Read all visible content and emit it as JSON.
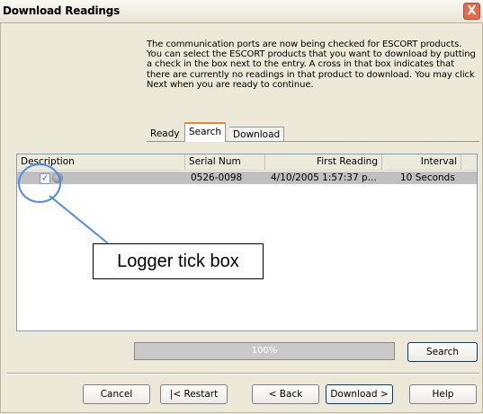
{
  "window": {
    "title": "Download Readings",
    "close": "X"
  },
  "intro_text": "The communication ports are now being checked for ESCORT products. You can select the ESCORT products that you want to download by putting a check in the box next to the entry. A cross in that box indicates that there are currently no readings in that product to download. You may click Next when you are ready to continue.",
  "tabs": [
    {
      "label": "Ready"
    },
    {
      "label": "Search"
    },
    {
      "label": "Download"
    }
  ],
  "list": {
    "columns": {
      "description": "Description",
      "serial": "Serial Num",
      "first": "First Reading",
      "interval": "Interval"
    },
    "rows": [
      {
        "checked": "✓",
        "serial": "0526-0098",
        "first": "4/10/2005 1:57:37 p...",
        "interval": "10 Seconds"
      }
    ]
  },
  "callout": {
    "label": "Logger tick box"
  },
  "progress": {
    "text": "100%",
    "value": 1.0
  },
  "buttons": {
    "search": "Search",
    "cancel": "Cancel",
    "restart": "|< Restart",
    "back": "< Back",
    "download": "Download >",
    "help": "Help"
  },
  "colors": {
    "accent": "#4e8ce6",
    "titlebar": "#e6e4d8",
    "row_highlight": "#c0c0c0"
  }
}
